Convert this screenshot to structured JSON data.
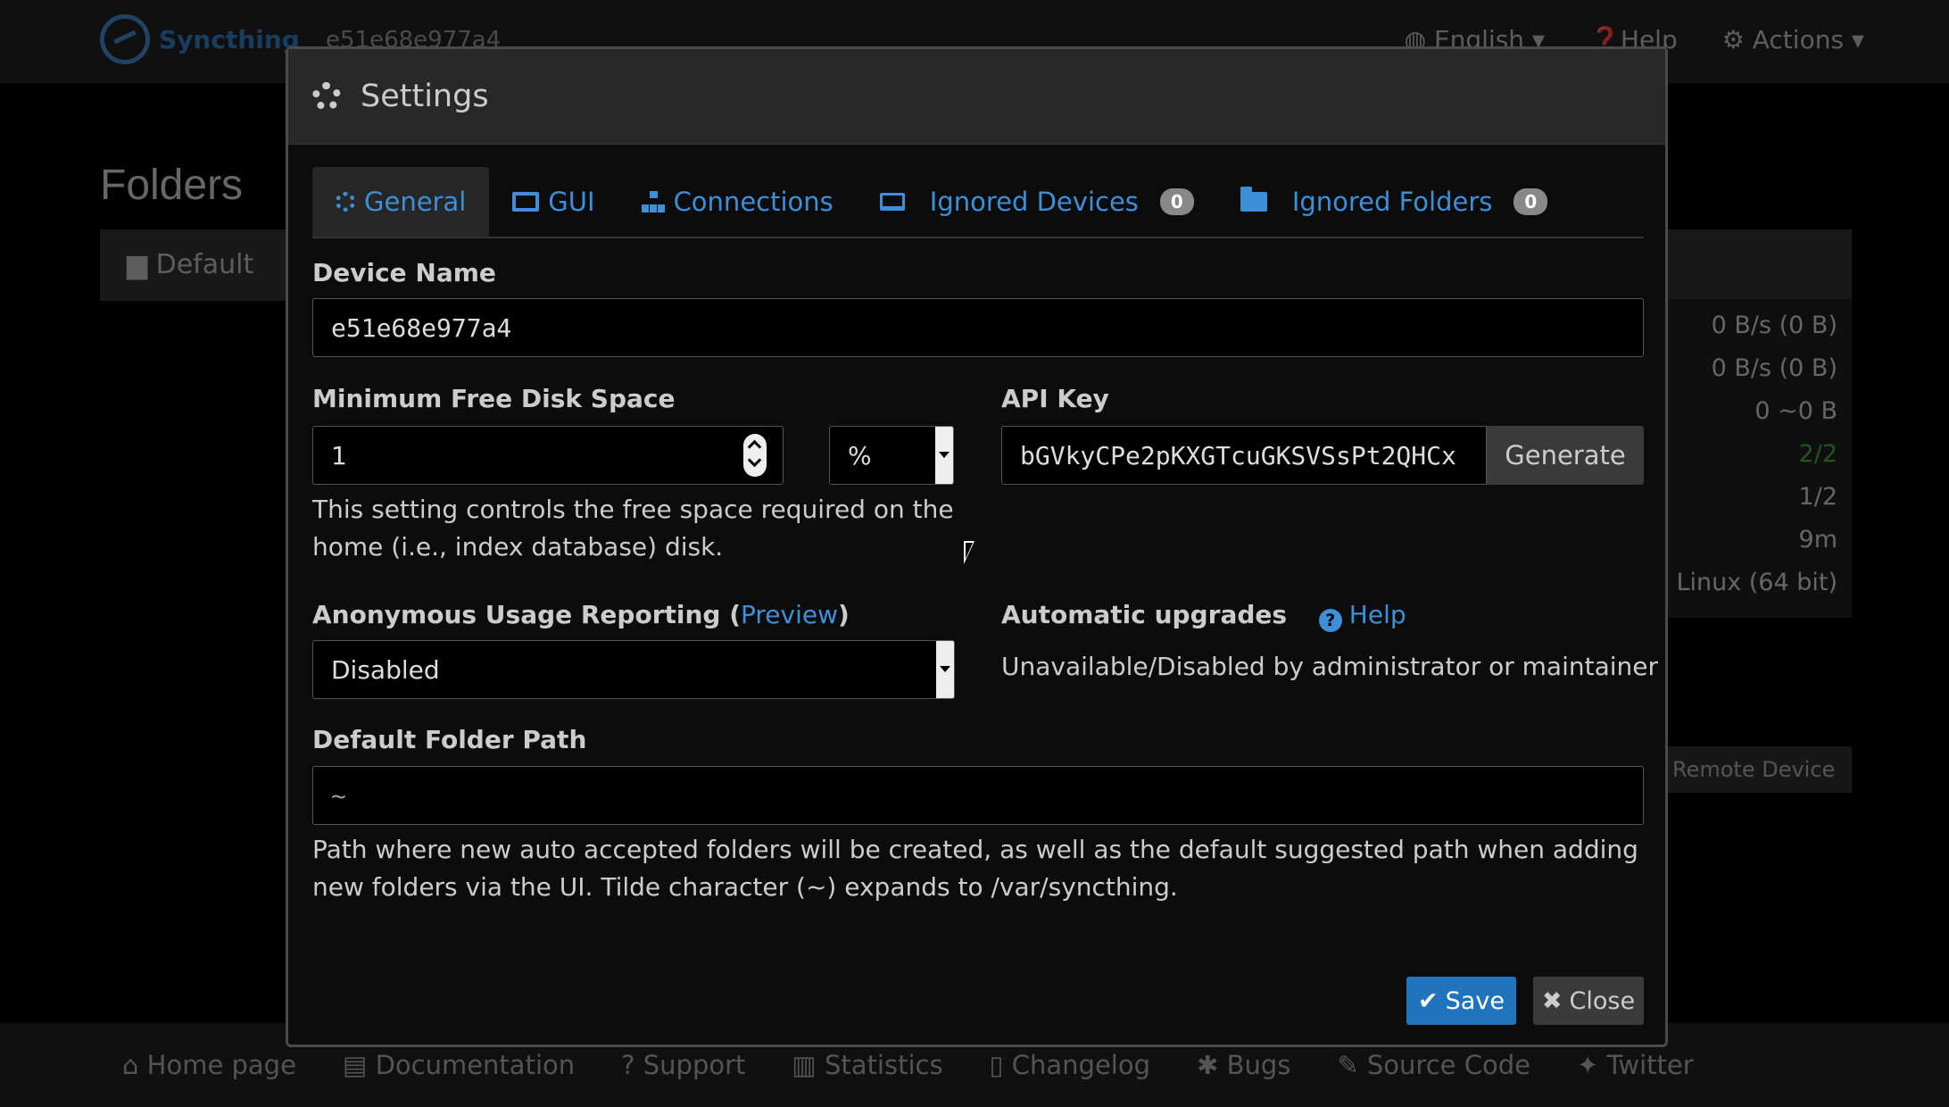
{
  "navbar": {
    "brand": "Syncthing",
    "device_id": "e51e68e977a4",
    "language": "English",
    "help": "Help",
    "actions": "Actions"
  },
  "background": {
    "folders_heading": "Folders",
    "folder_name": "Default",
    "device_rows": [
      "0 B/s (0 B)",
      "0 B/s (0 B)",
      "0  ~0 B",
      "2/2",
      "1/2",
      "9m",
      "Linux (64 bit)"
    ],
    "remote_device_button": "Remote Device"
  },
  "footer": {
    "links": [
      "Home page",
      "Documentation",
      "Support",
      "Statistics",
      "Changelog",
      "Bugs",
      "Source Code",
      "Twitter"
    ]
  },
  "modal": {
    "title": "Settings",
    "tabs": [
      {
        "label": "General",
        "icon": "gear-icon"
      },
      {
        "label": "GUI",
        "icon": "monitor-icon"
      },
      {
        "label": "Connections",
        "icon": "network-icon"
      },
      {
        "label": "Ignored Devices",
        "icon": "laptop-icon",
        "badge": "0"
      },
      {
        "label": "Ignored Folders",
        "icon": "folder-icon",
        "badge": "0"
      }
    ],
    "device_name": {
      "label": "Device Name",
      "value": "e51e68e977a4"
    },
    "min_disk": {
      "label": "Minimum Free Disk Space",
      "value": "1",
      "unit": "%",
      "help": "This setting controls the free space required on the home (i.e., index database) disk."
    },
    "api_key": {
      "label": "API Key",
      "value": "bGVkyCPe2pKXGTcuGKSVSsPt2QHCx",
      "generate": "Generate"
    },
    "usage_reporting": {
      "label": "Anonymous Usage Reporting",
      "preview": "Preview",
      "value": "Disabled"
    },
    "auto_upgrades": {
      "label": "Automatic upgrades",
      "help_link": "Help",
      "status": "Unavailable/Disabled by administrator or maintainer"
    },
    "default_folder_path": {
      "label": "Default Folder Path",
      "value": "~",
      "help": "Path where new auto accepted folders will be created, as well as the default suggested path when adding new folders via the UI. Tilde character (~) expands to /var/syncthing."
    },
    "save_label": "Save",
    "close_label": "Close"
  },
  "colors": {
    "accent": "#3d8fd9",
    "save_button": "#1f74bd",
    "background": "#000000"
  }
}
